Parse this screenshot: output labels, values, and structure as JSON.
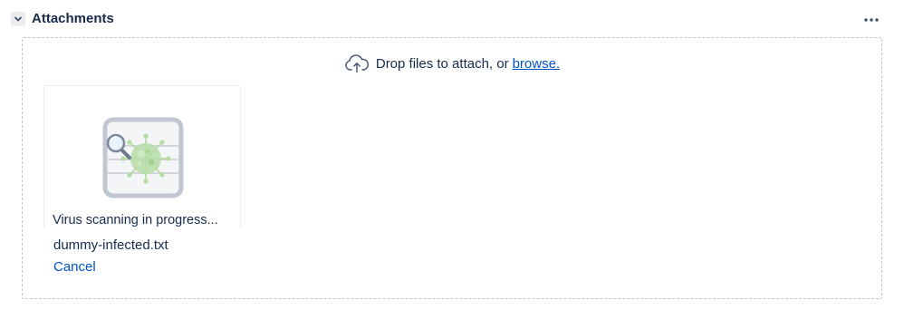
{
  "header": {
    "title": "Attachments",
    "collapse_icon": "chevron-down-icon",
    "more_icon": "more-horizontal-icon"
  },
  "dropzone": {
    "text": "Drop files to attach, or",
    "link": "browse.",
    "icon": "cloud-upload-icon"
  },
  "attachment": {
    "status": "Virus scanning in progress...",
    "file_name": "dummy-infected.txt",
    "cancel_label": "Cancel",
    "thumbnail_icon": "virus-scan-icon"
  },
  "colors": {
    "text": "#172b4d",
    "link": "#0052cc",
    "border": "#c1c7d0",
    "virus": "#9fd28a"
  }
}
